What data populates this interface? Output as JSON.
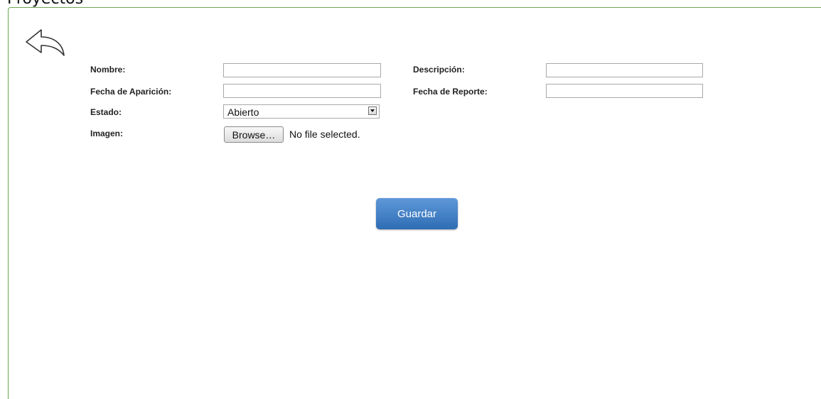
{
  "page": {
    "title": "Proyectos"
  },
  "back": {
    "icon": "back-arrow-icon"
  },
  "form": {
    "nombre_label": "Nombre:",
    "nombre_value": "",
    "descripcion_label": "Descripción:",
    "descripcion_value": "",
    "fecha_aparicion_label": "Fecha de Aparición:",
    "fecha_aparicion_value": "",
    "fecha_reporte_label": "Fecha de Reporte:",
    "fecha_reporte_value": "",
    "estado_label": "Estado:",
    "estado_selected": "Abierto",
    "imagen_label": "Imagen:",
    "browse_label": "Browse…",
    "file_status": "No file selected."
  },
  "actions": {
    "save_label": "Guardar"
  },
  "colors": {
    "panel_border": "#6aa84f",
    "save_button": "#3d7cc4",
    "save_text": "#ffffff"
  }
}
